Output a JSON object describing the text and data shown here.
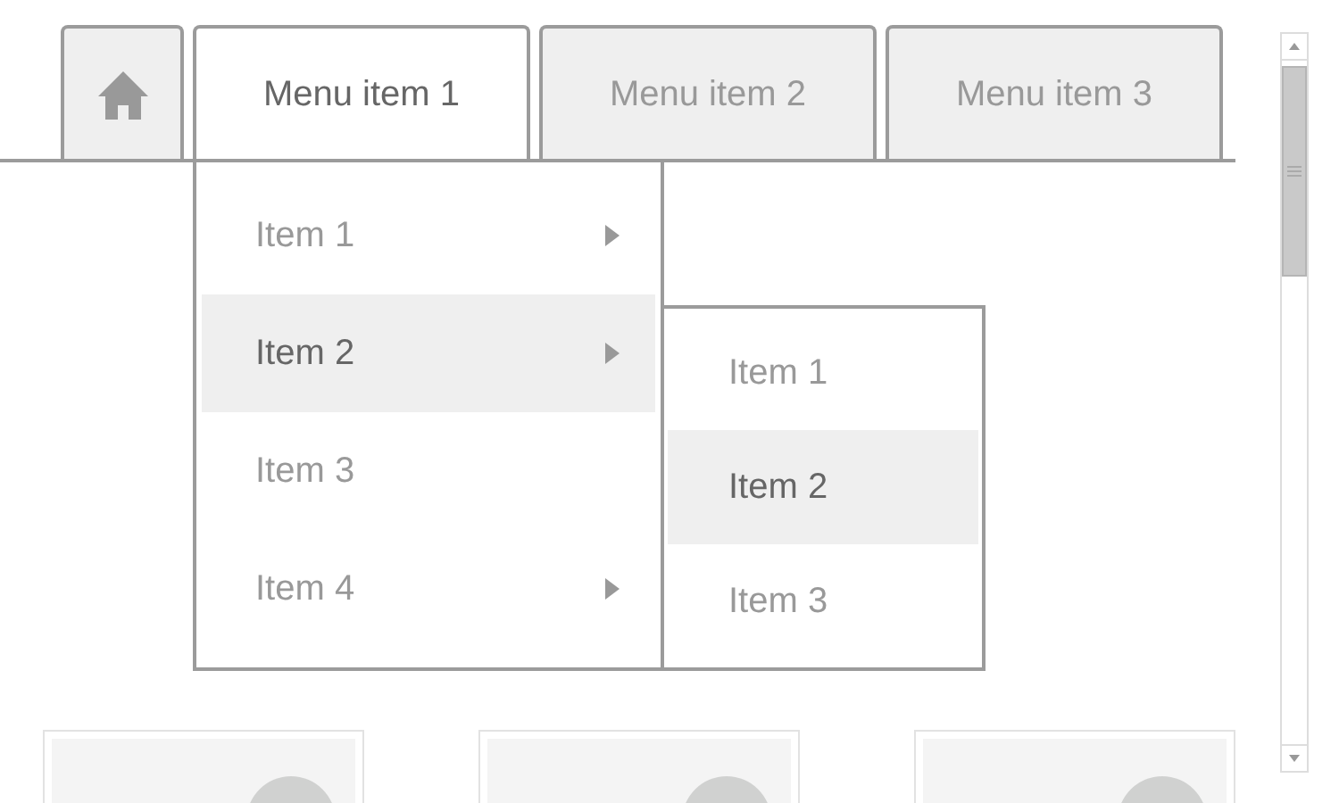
{
  "tabs": [
    {
      "kind": "home",
      "selected": false
    },
    {
      "kind": "text",
      "label": "Menu item 1",
      "selected": true
    },
    {
      "kind": "text",
      "label": "Menu item 2",
      "selected": false
    },
    {
      "kind": "text",
      "label": "Menu item 3",
      "selected": false
    }
  ],
  "dropdown": {
    "items": [
      {
        "label": "Item 1",
        "has_submenu": true,
        "selected": false
      },
      {
        "label": "Item 2",
        "has_submenu": true,
        "selected": true
      },
      {
        "label": "Item 3",
        "has_submenu": false,
        "selected": false
      },
      {
        "label": "Item 4",
        "has_submenu": true,
        "selected": false
      }
    ]
  },
  "submenu": {
    "items": [
      {
        "label": "Item 1",
        "selected": false
      },
      {
        "label": "Item 2",
        "selected": true
      },
      {
        "label": "Item 3",
        "selected": false
      }
    ]
  }
}
